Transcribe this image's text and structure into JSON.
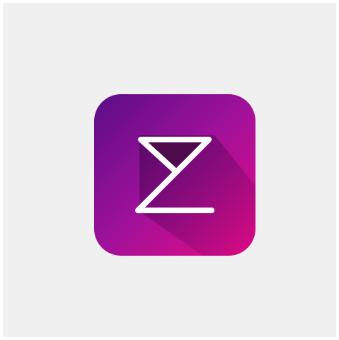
{
  "app_icon": {
    "name": "z-hourglass-logo-icon",
    "colors": {
      "gradient_start": "#5b0d86",
      "gradient_mid": "#a0119a",
      "gradient_end": "#ea0a86",
      "glyph": "#ffffff",
      "shadow": "#5a0555",
      "triangle_fill": "#4e0a4a",
      "background": "#f0f0f0"
    }
  }
}
